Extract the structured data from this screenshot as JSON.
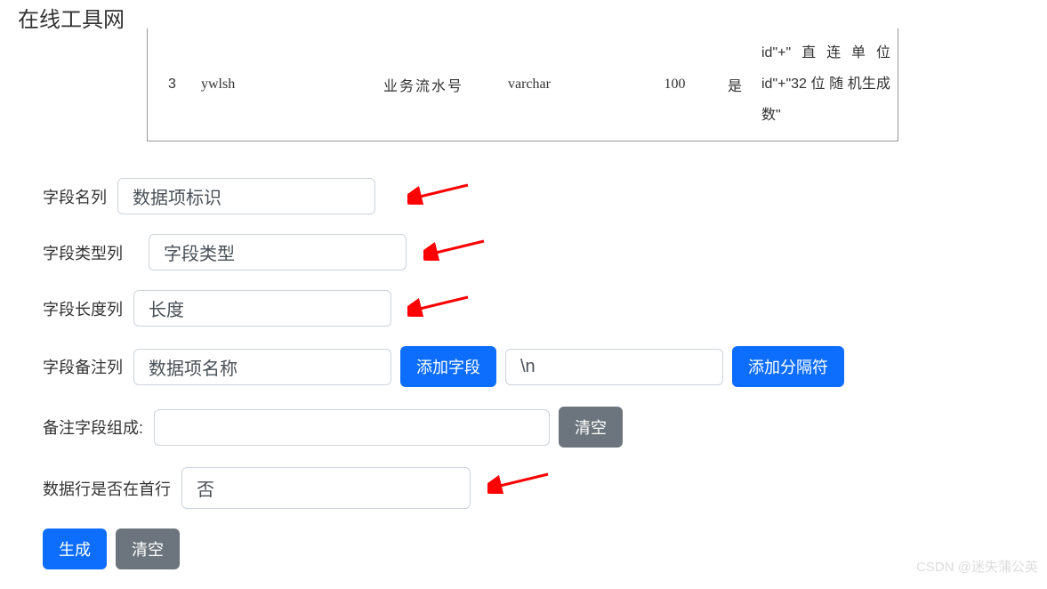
{
  "header": {
    "title": "在线工具网"
  },
  "table": {
    "row": {
      "idx": "3",
      "field": "ywlsh",
      "name": "业务流水号",
      "type": "varchar",
      "length": "100",
      "required": "是",
      "remark": "id\"+\"直连单位id\"+\"32 位 随 机生成数\""
    }
  },
  "form": {
    "fieldNameLabel": "字段名列",
    "fieldNameValue": "数据项标识",
    "fieldTypeLabel": "字段类型列",
    "fieldTypeValue": "字段类型",
    "fieldLengthLabel": "字段长度列",
    "fieldLengthValue": "长度",
    "fieldRemarkLabel": "字段备注列",
    "fieldRemarkValue": "数据项名称",
    "addFieldBtn": "添加字段",
    "separatorValue": "\\n",
    "addSeparatorBtn": "添加分隔符",
    "remarkComposeLabel": "备注字段组成:",
    "remarkComposeValue": "",
    "clearBtn": "清空",
    "firstRowLabel": "数据行是否在首行",
    "firstRowValue": "否",
    "generateBtn": "生成",
    "clearBtn2": "清空"
  },
  "watermark": "CSDN @迷失蒲公英"
}
